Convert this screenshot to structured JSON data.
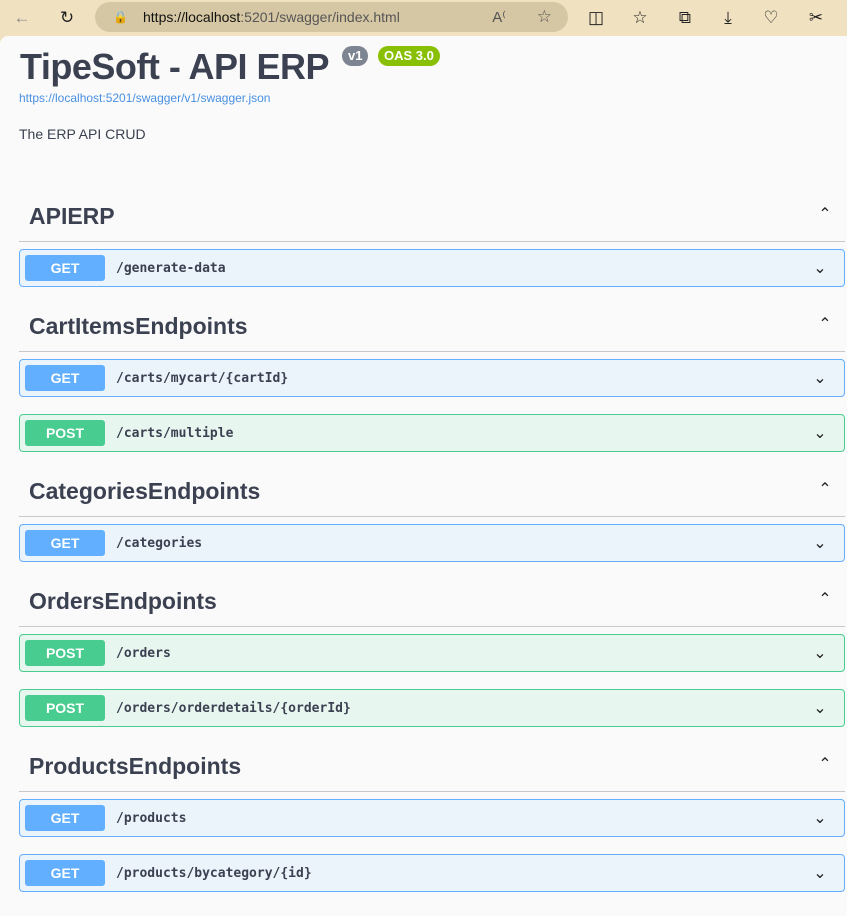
{
  "browser": {
    "url_host": "https://localhost",
    "url_rest": ":5201/swagger/index.html",
    "icons": [
      "back-icon",
      "refresh-icon",
      "lock-icon",
      "read-aloud-icon",
      "favorite-star-icon",
      "split-screen-icon",
      "favorites-icon",
      "collections-icon",
      "download-icon",
      "browser-essentials-icon",
      "screenshot-icon"
    ]
  },
  "header": {
    "title": "TipeSoft - API ERP",
    "version_badge": "v1",
    "oas_badge": "OAS 3.0",
    "json_link": "https://localhost:5201/swagger/v1/swagger.json",
    "description": "The ERP API CRUD"
  },
  "colors": {
    "get": "#61affe",
    "post": "#49cc90",
    "version_badge": "#89bf04"
  },
  "sections": [
    {
      "name": "APIERP",
      "ops": [
        {
          "method": "GET",
          "path": "/generate-data"
        }
      ]
    },
    {
      "name": "CartItemsEndpoints",
      "ops": [
        {
          "method": "GET",
          "path": "/carts/mycart/{cartId}"
        },
        {
          "method": "POST",
          "path": "/carts/multiple"
        }
      ]
    },
    {
      "name": "CategoriesEndpoints",
      "ops": [
        {
          "method": "GET",
          "path": "/categories"
        }
      ]
    },
    {
      "name": "OrdersEndpoints",
      "ops": [
        {
          "method": "POST",
          "path": "/orders"
        },
        {
          "method": "POST",
          "path": "/orders/orderdetails/{orderId}"
        }
      ]
    },
    {
      "name": "ProductsEndpoints",
      "ops": [
        {
          "method": "GET",
          "path": "/products"
        },
        {
          "method": "GET",
          "path": "/products/bycategory/{id}"
        }
      ]
    }
  ]
}
